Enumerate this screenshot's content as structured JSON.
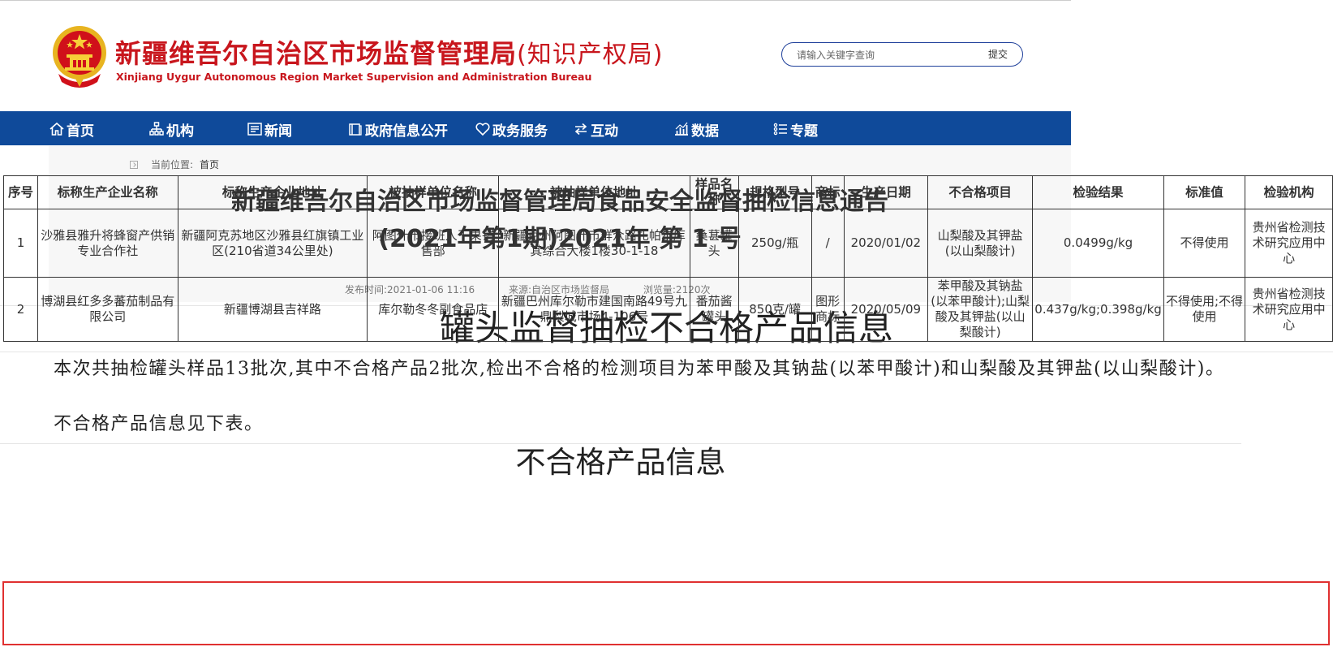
{
  "header": {
    "title": "新疆维吾尔自治区市场监督管理局",
    "title_suffix": "(知识产权局)",
    "title_en": "Xinjiang Uygur Autonomous Region Market Supervision and Administration Bureau",
    "search_placeholder": "请输入关键字查询",
    "search_button": "提交"
  },
  "nav": {
    "items": [
      {
        "label": "首页",
        "icon": "home-icon"
      },
      {
        "label": "机构",
        "icon": "org-chart-icon"
      },
      {
        "label": "新闻",
        "icon": "news-icon"
      },
      {
        "label": "政府信息公开",
        "icon": "book-icon"
      },
      {
        "label": "政务服务",
        "icon": "heart-icon"
      },
      {
        "label": "互动",
        "icon": "exchange-icon"
      },
      {
        "label": "数据",
        "icon": "chart-icon"
      },
      {
        "label": "专题",
        "icon": "list-icon"
      }
    ]
  },
  "breadcrumb": {
    "prefix": "当前位置:",
    "home": "首页"
  },
  "article": {
    "title_line1": "新疆维吾尔自治区市场监督管理局食品安全监督抽检信息通告",
    "title_line2": "(2021年第1期)2021年 第 1 号",
    "publish_time": "发布时间:2021-01-06 11:16",
    "source": "来源:自治区市场监督局",
    "views": "浏览量:2120次"
  },
  "doc": {
    "title": "罐头监督抽检不合格产品信息",
    "paragraph1": "本次共抽检罐头样品13批次,其中不合格产品2批次,检出不合格的检测项目为苯甲酸及其钠盐(以苯甲酸计)和山梨酸及其钾盐(以山梨酸计)。",
    "paragraph2": "不合格产品信息见下表。",
    "table_title": "不合格产品信息"
  },
  "table": {
    "headers": [
      "序号",
      "标称生产企业名称",
      "标称生产企业地址",
      "被抽样单位名称",
      "被抽样单位地址",
      "样品名称",
      "规格型号",
      "商标",
      "生产日期",
      "不合格项目",
      "检验结果",
      "标准值",
      "检验机构"
    ],
    "rows": [
      [
        "1",
        "沙雅县雅升将蜂窗产供销专业合作社",
        "新疆阿克苏地区沙雅县红旗镇工业区(210省道34公里处)",
        "阿图什市接班人干果销售部",
        "新疆克州阿图什市群众路扎帕尔库其综合大楼1楼30-1-18",
        "桑葚罐头",
        "250g/瓶",
        "/",
        "2020/01/02",
        "山梨酸及其钾盐(以山梨酸计)",
        "0.0499g/kg",
        "不得使用",
        "贵州省检测技术研究应用中心"
      ],
      [
        "2",
        "博湖县红多多蕃茄制品有限公司",
        "新疆博湖县吉祥路",
        "库尔勒冬冬副食品店",
        "新疆巴州库尔勒市建国南路49号九鼎梨城市场4-106号",
        "番茄酱罐头",
        "850克/罐",
        "图形商标",
        "2020/05/09",
        "苯甲酸及其钠盐(以苯甲酸计);山梨酸及其钾盐(以山梨酸计)",
        "0.437g/kg;0.398g/kg",
        "不得使用;不得使用",
        "贵州省检测技术研究应用中心"
      ]
    ]
  },
  "colors": {
    "brand_red": "#c8161d",
    "nav_blue": "#0f4a9a",
    "highlight_red": "#e03030"
  }
}
